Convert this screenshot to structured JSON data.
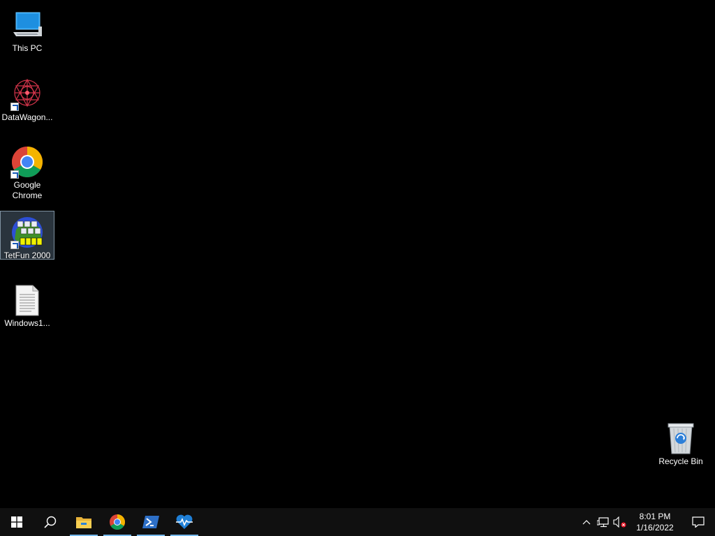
{
  "desktop": {
    "icons": [
      {
        "label": "This PC",
        "icon": "computer-icon"
      },
      {
        "label": "DataWagon...",
        "icon": "datawagon-icon"
      },
      {
        "label": "Google Chrome",
        "icon": "chrome-icon"
      },
      {
        "label": "TetFun 2000",
        "icon": "tetfun-icon"
      },
      {
        "label": "Windows1...",
        "icon": "text-document-icon"
      },
      {
        "label": "Recycle Bin",
        "icon": "recycle-bin-icon"
      }
    ]
  },
  "taskbar": {
    "start": "windows-start-icon",
    "search": "search-icon",
    "pinned": [
      {
        "name": "file-explorer-icon",
        "running": true
      },
      {
        "name": "chrome-icon",
        "running": true
      },
      {
        "name": "powershell-icon",
        "running": true
      },
      {
        "name": "health-monitor-icon",
        "running": true
      }
    ],
    "tray": {
      "icons": [
        "chevron-up-icon",
        "network-icon",
        "volume-muted-icon"
      ],
      "time": "8:01 PM",
      "date": "1/16/2022",
      "notification": "action-center-icon"
    }
  },
  "colors": {
    "background": "#000000",
    "taskbar": "#101010",
    "accent": "#76b9ed"
  }
}
